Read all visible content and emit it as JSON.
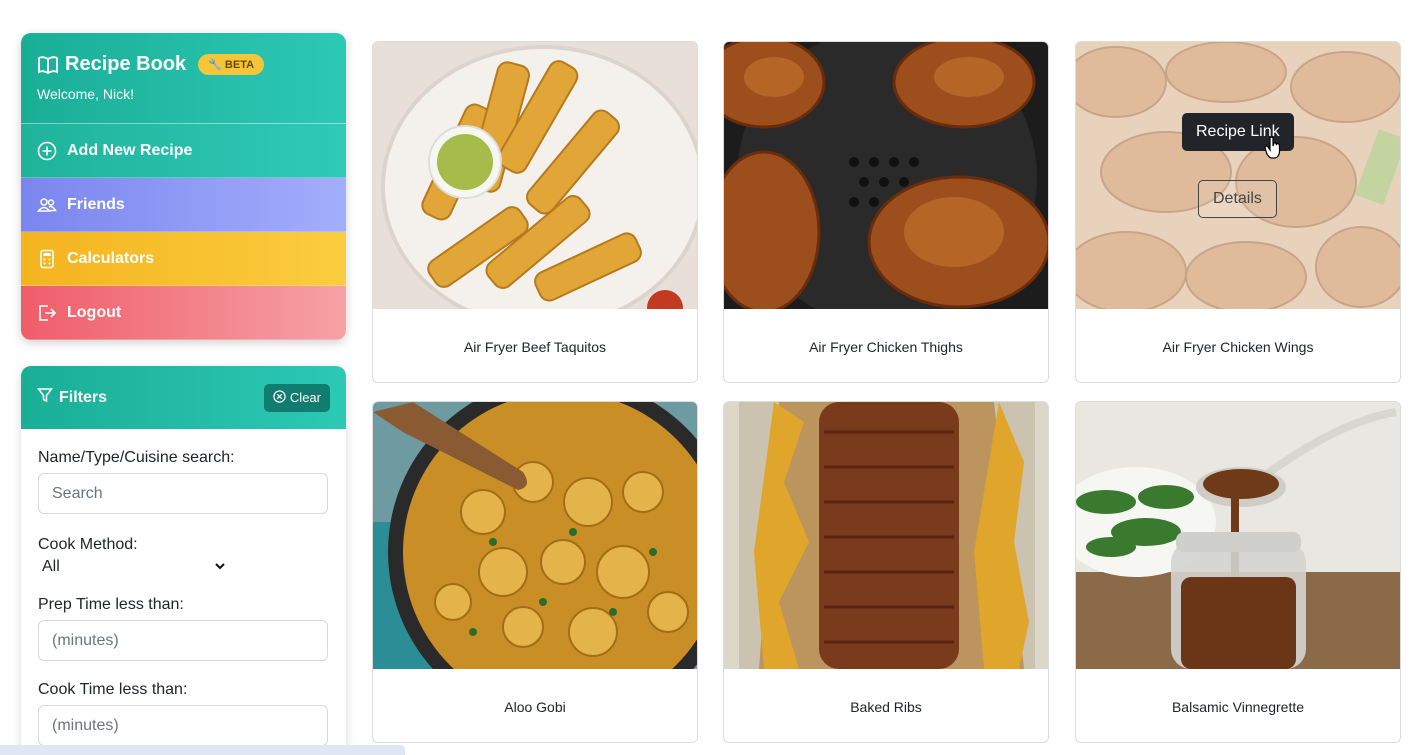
{
  "app": {
    "title": "Recipe Book",
    "badge": "BETA",
    "welcome": "Welcome, Nick!"
  },
  "menu": {
    "add": "Add New Recipe",
    "friends": "Friends",
    "calculators": "Calculators",
    "logout": "Logout"
  },
  "filters": {
    "title": "Filters",
    "clear": "Clear",
    "search_label": "Name/Type/Cuisine search:",
    "search_placeholder": "Search",
    "method_label": "Cook Method:",
    "method_value": "All",
    "prep_label": "Prep Time less than:",
    "prep_placeholder": "(minutes)",
    "cook_label": "Cook Time less than:",
    "cook_placeholder": "(minutes)"
  },
  "recipes": [
    {
      "name": "Air Fryer Beef Taquitos"
    },
    {
      "name": "Air Fryer Chicken Thighs"
    },
    {
      "name": "Air Fryer Chicken Wings",
      "hover_tooltip": "Recipe Link",
      "hover_button": "Details"
    },
    {
      "name": "Aloo Gobi"
    },
    {
      "name": "Baked Ribs"
    },
    {
      "name": "Balsamic Vinnegrette"
    }
  ],
  "colors": {
    "teal": "#1aae96",
    "purple": "#7a86ee",
    "yellow": "#f4b41f",
    "red": "#ef5d6a"
  }
}
